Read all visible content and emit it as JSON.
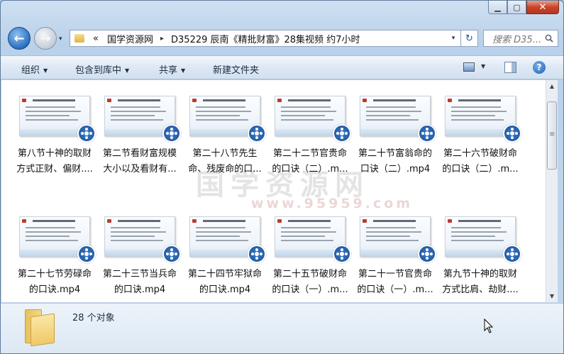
{
  "window": {
    "minimize": "▁",
    "maximize": "▢",
    "close": "✕"
  },
  "nav": {
    "back_glyph": "←",
    "forward_glyph": "→",
    "dropdown_glyph": "▾",
    "breadcrumb_overflow": "«",
    "breadcrumbs": [
      "国学资源网",
      "D35229 辰南《精批财富》28集视频 约7小时"
    ],
    "breadcrumb_sep": "▸",
    "refresh_glyph": "↻",
    "search_placeholder": "搜索 D35...",
    "search_icon": "search-icon"
  },
  "toolbar": {
    "organize": "组织",
    "include_in_library": "包含到库中",
    "share": "共享",
    "new_folder": "新建文件夹",
    "help": "?"
  },
  "watermark": {
    "line1": "国学资源网",
    "line2": "www.95959.com"
  },
  "files": [
    {
      "line1": "第八节十神的取财",
      "line2": "方式正财、偏财...."
    },
    {
      "line1": "第二节看财富规模",
      "line2": "大小以及看财有..."
    },
    {
      "line1": "第二十八节先生",
      "line2": "命、残废命的口..."
    },
    {
      "line1": "第二十二节官贵命",
      "line2": "的口诀（二）.m..."
    },
    {
      "line1": "第二十节富翁命的",
      "line2": "口诀（二）.mp4"
    },
    {
      "line1": "第二十六节破财命",
      "line2": "的口诀（二）.m..."
    },
    {
      "line1": "第二十七节劳碌命",
      "line2": "的口诀.mp4"
    },
    {
      "line1": "第二十三节当兵命",
      "line2": "的口诀.mp4"
    },
    {
      "line1": "第二十四节牢狱命",
      "line2": "的口诀.mp4"
    },
    {
      "line1": "第二十五节破财命",
      "line2": "的口诀（一）.m..."
    },
    {
      "line1": "第二十一节官贵命",
      "line2": "的口诀（一）.m..."
    },
    {
      "line1": "第九节十神的取财",
      "line2": "方式比肩、劫财...."
    }
  ],
  "details": {
    "count": "28 个对象"
  }
}
